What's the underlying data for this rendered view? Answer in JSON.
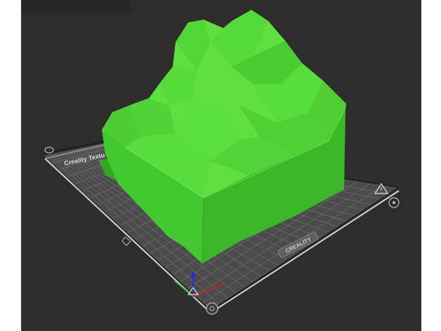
{
  "viewport": {
    "background_color": "#2d2d2d",
    "panel_color": "#262626"
  },
  "bed": {
    "brand_label": "CREALITY",
    "corner_label": "Creality Textu",
    "surface_color": "#4b4b4b",
    "grid_color": "#6a6a6a",
    "border_color": "#2f2f2f",
    "accent_light": "#d6d6d6",
    "icons": [
      "warning-icon",
      "clip-icon",
      "fan-icon",
      "logo-badge-icon"
    ]
  },
  "model": {
    "color_front": "#42c930",
    "color_top": "#5fe040",
    "color_shadow": "#33a823"
  },
  "axes": {
    "x_color": "#d02020",
    "y_color": "#20b020",
    "z_color": "#2030d0"
  }
}
